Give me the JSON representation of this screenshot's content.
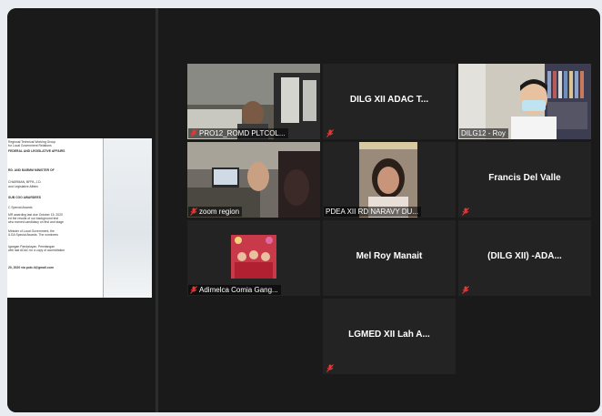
{
  "document": {
    "lines": [
      "Regional Technical Working Group",
      "for Local Government Relations",
      "FEDERAL AND LEGISLATIVE AFFAIRS",
      "RD. AND BARMM MINISTER OF",
      "CHAIRMAN, BFPA, J.D.",
      "and Legislative Affairs",
      "SUB CGO AWARDEES",
      "C Special Awards",
      "MR awarding last due October 15, 2020",
      "ed the results of our background test",
      "who earned candidacy on first and stage",
      "Minister of Local Government, the",
      "ILGA Special Awards. The nominees",
      "Igangan Pandaluyan, Pemitangan",
      "with last ADAC for a copy of accreditation",
      "20, 2020 via potc.ii@gmail.com"
    ]
  },
  "participants": [
    {
      "name": "PRO12_ROMD PLTCOL...",
      "label_shown": true
    },
    {
      "name": "DILG XII ADAC T...",
      "label_shown": false
    },
    {
      "name": "DILG12 - Roy",
      "label_shown": true
    },
    {
      "name": "zoom region",
      "label_shown": true
    },
    {
      "name": "PDEA XII RD NARAVY DU...",
      "label_shown": true
    },
    {
      "name": "Francis Del Valle",
      "label_shown": false
    },
    {
      "name": "Adimelca Comia Gang...",
      "label_shown": true
    },
    {
      "name": "Mel Roy Manait",
      "label_shown": false
    },
    {
      "name": "(DILG XII) -ADA...",
      "label_shown": false
    },
    {
      "name": "LGMED XII Lah A...",
      "label_shown": false
    }
  ],
  "colors": {
    "active_speaker": "#c9f24a",
    "tile_bg": "#232323",
    "mute_icon": "#e53935"
  }
}
